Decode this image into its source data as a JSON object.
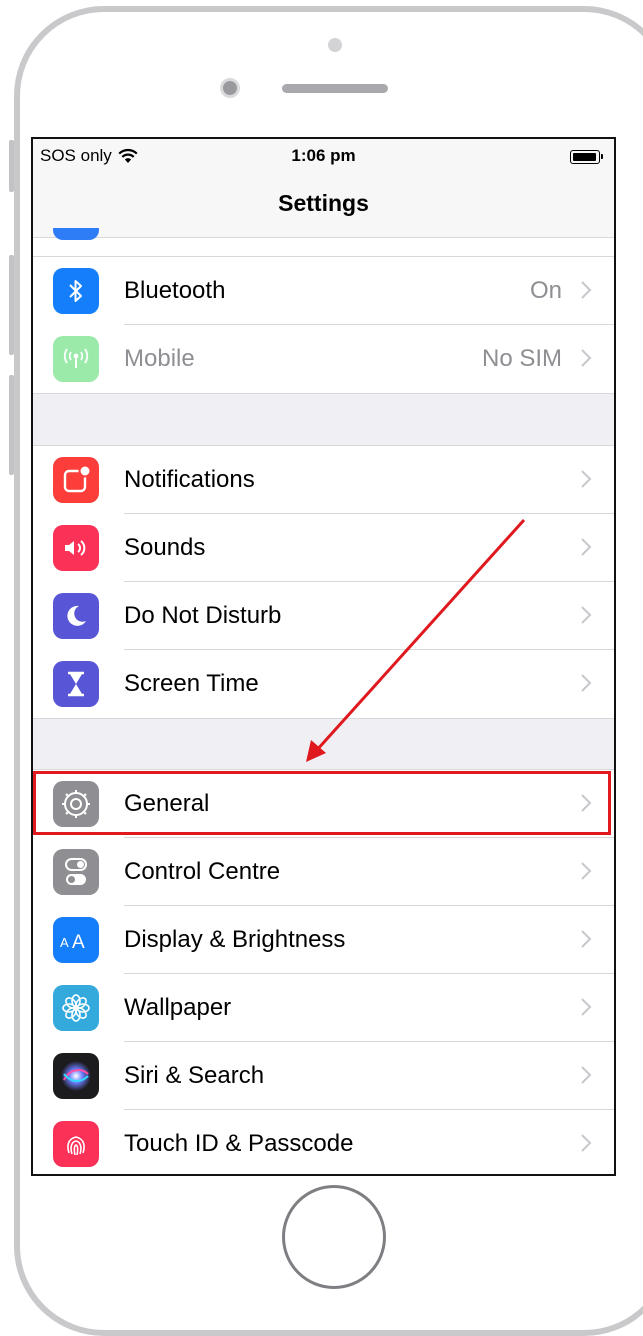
{
  "status_bar": {
    "carrier": "SOS only",
    "time": "1:06 pm"
  },
  "nav": {
    "title": "Settings"
  },
  "connectivity": [
    {
      "label": "Bluetooth",
      "value": "On",
      "icon": "bluetooth-icon",
      "color": "#147efb"
    },
    {
      "label": "Mobile",
      "value": "No SIM",
      "icon": "antenna-icon",
      "color": "#4cd964",
      "disabled": true
    }
  ],
  "notifications_group": [
    {
      "label": "Notifications",
      "icon": "notifications-icon",
      "color": "#fc3d39"
    },
    {
      "label": "Sounds",
      "icon": "speaker-icon",
      "color": "#fc3158"
    },
    {
      "label": "Do Not Disturb",
      "icon": "moon-icon",
      "color": "#5856d6"
    },
    {
      "label": "Screen Time",
      "icon": "hourglass-icon",
      "color": "#5856d6"
    }
  ],
  "general_group": [
    {
      "label": "General",
      "icon": "gear-icon",
      "color": "#8e8e93",
      "highlighted": true
    },
    {
      "label": "Control Centre",
      "icon": "toggles-icon",
      "color": "#8e8e93"
    },
    {
      "label": "Display & Brightness",
      "icon": "text-size-icon",
      "color": "#147efb"
    },
    {
      "label": "Wallpaper",
      "icon": "flower-icon",
      "color": "#34aadc"
    },
    {
      "label": "Siri & Search",
      "icon": "siri-icon",
      "color": "#1c1c1e"
    },
    {
      "label": "Touch ID & Passcode",
      "icon": "fingerprint-icon",
      "color": "#fc3158"
    }
  ],
  "annotation": {
    "highlight_color": "#e0191e"
  }
}
